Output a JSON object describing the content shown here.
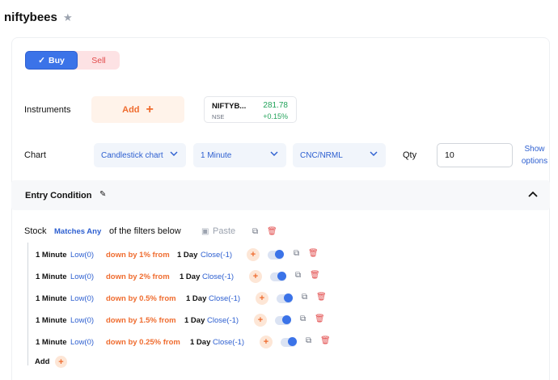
{
  "header": {
    "title": "niftybees",
    "star_icon": "star-icon"
  },
  "order": {
    "buy_label": "Buy",
    "sell_label": "Sell",
    "buy_color": "#3b73e8",
    "sell_color": "#e24c4c"
  },
  "instruments": {
    "label": "Instruments",
    "add_label": "Add",
    "item": {
      "symbol": "NIFTYB...",
      "exchange": "NSE",
      "price": "281.78",
      "change": "+0.15%"
    }
  },
  "chart": {
    "label": "Chart",
    "chart_type": "Candlestick chart",
    "interval": "1 Minute",
    "product": "CNC/NRML",
    "qty_label": "Qty",
    "qty_value": "10",
    "show_options": "Show options"
  },
  "entry": {
    "title": "Entry Condition",
    "stock_label": "Stock",
    "match_mode": "Matches Any",
    "filters_text": "of the filters below",
    "paste_label": "Paste",
    "rows": [
      {
        "interval": "1 Minute",
        "left": "Low(0)",
        "op": "down by 1% from",
        "period": "1 Day",
        "right": "Close(-1)"
      },
      {
        "interval": "1 Minute",
        "left": "Low(0)",
        "op": "down by 2% from",
        "period": "1 Day",
        "right": "Close(-1)"
      },
      {
        "interval": "1 Minute",
        "left": "Low(0)",
        "op": "down by 0.5% from",
        "period": "1 Day",
        "right": "Close(-1)"
      },
      {
        "interval": "1 Minute",
        "left": "Low(0)",
        "op": "down by 1.5% from",
        "period": "1 Day",
        "right": "Close(-1)"
      },
      {
        "interval": "1 Minute",
        "left": "Low(0)",
        "op": "down by 0.25% from",
        "period": "1 Day",
        "right": "Close(-1)"
      }
    ],
    "add_label": "Add"
  }
}
